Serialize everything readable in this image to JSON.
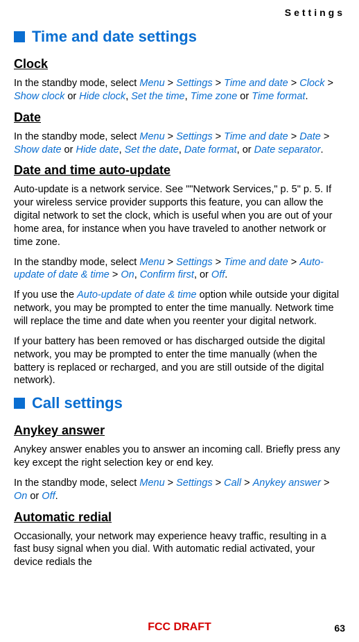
{
  "header": "Settings",
  "sections": {
    "timeDate": {
      "title": "Time and date settings",
      "clock": {
        "heading": "Clock",
        "intro": "In the standby mode, select ",
        "path1": "Menu",
        "path2": "Settings",
        "path3": "Time and date",
        "path4": "Clock",
        "opt1": "Show clock",
        "or1": " or ",
        "opt2": "Hide clock",
        "opt3": "Set the time",
        "opt4": "Time zone",
        "or2": " or ",
        "opt5": "Time format",
        "end": "."
      },
      "date": {
        "heading": "Date",
        "intro": "In the standby mode, select ",
        "path1": "Menu",
        "path2": "Settings",
        "path3": "Time and date",
        "path4": "Date",
        "opt1": "Show date",
        "or1": " or ",
        "opt2": "Hide date",
        "opt3": "Set the date",
        "opt4": "Date format",
        "or2": ", or ",
        "opt5": "Date separator",
        "end": "."
      },
      "autoUpdate": {
        "heading": "Date and time auto-update",
        "p1": "Auto-update is a network service. See \"\"Network Services,\" p. 5\" p. 5. If your wireless service provider supports this feature, you can allow the digital network to set the clock, which is useful when you are out of your home area, for instance when you have traveled to another network or time zone.",
        "p2intro": "In the standby mode, select ",
        "p2path1": "Menu",
        "p2path2": "Settings",
        "p2path3": "Time and date",
        "p2path4": "Auto-update of date & time",
        "p2opt1": "On",
        "p2opt2": "Confirm first",
        "p2or": ", or ",
        "p2opt3": "Off",
        "p2end": ".",
        "p3a": "If you use the ",
        "p3link": "Auto-update of date & time",
        "p3b": " option while outside your digital network, you may be prompted to enter the time manually. Network time will replace the time and date when you reenter your digital network.",
        "p4": "If your battery has been removed or has discharged outside the digital network, you may be prompted to enter the time manually (when the battery is replaced or recharged, and you are still outside of the digital network)."
      }
    },
    "callSettings": {
      "title": "Call settings",
      "anykey": {
        "heading": "Anykey answer",
        "p1": "Anykey answer enables you to answer an incoming call. Briefly press any key except the right selection key or end key.",
        "p2intro": "In the standby mode, select ",
        "p2path1": "Menu",
        "p2path2": "Settings",
        "p2path3": "Call",
        "p2path4": "Anykey answer",
        "p2opt1": "On",
        "p2or": " or ",
        "p2opt2": "Off",
        "p2end": "."
      },
      "autoRedial": {
        "heading": "Automatic redial",
        "p1": "Occasionally, your network may experience heavy traffic, resulting in a fast busy signal when you dial. With automatic redial activated, your device redials the"
      }
    }
  },
  "footer": {
    "fcc": "FCC DRAFT",
    "page": "63"
  },
  "sep": " > "
}
